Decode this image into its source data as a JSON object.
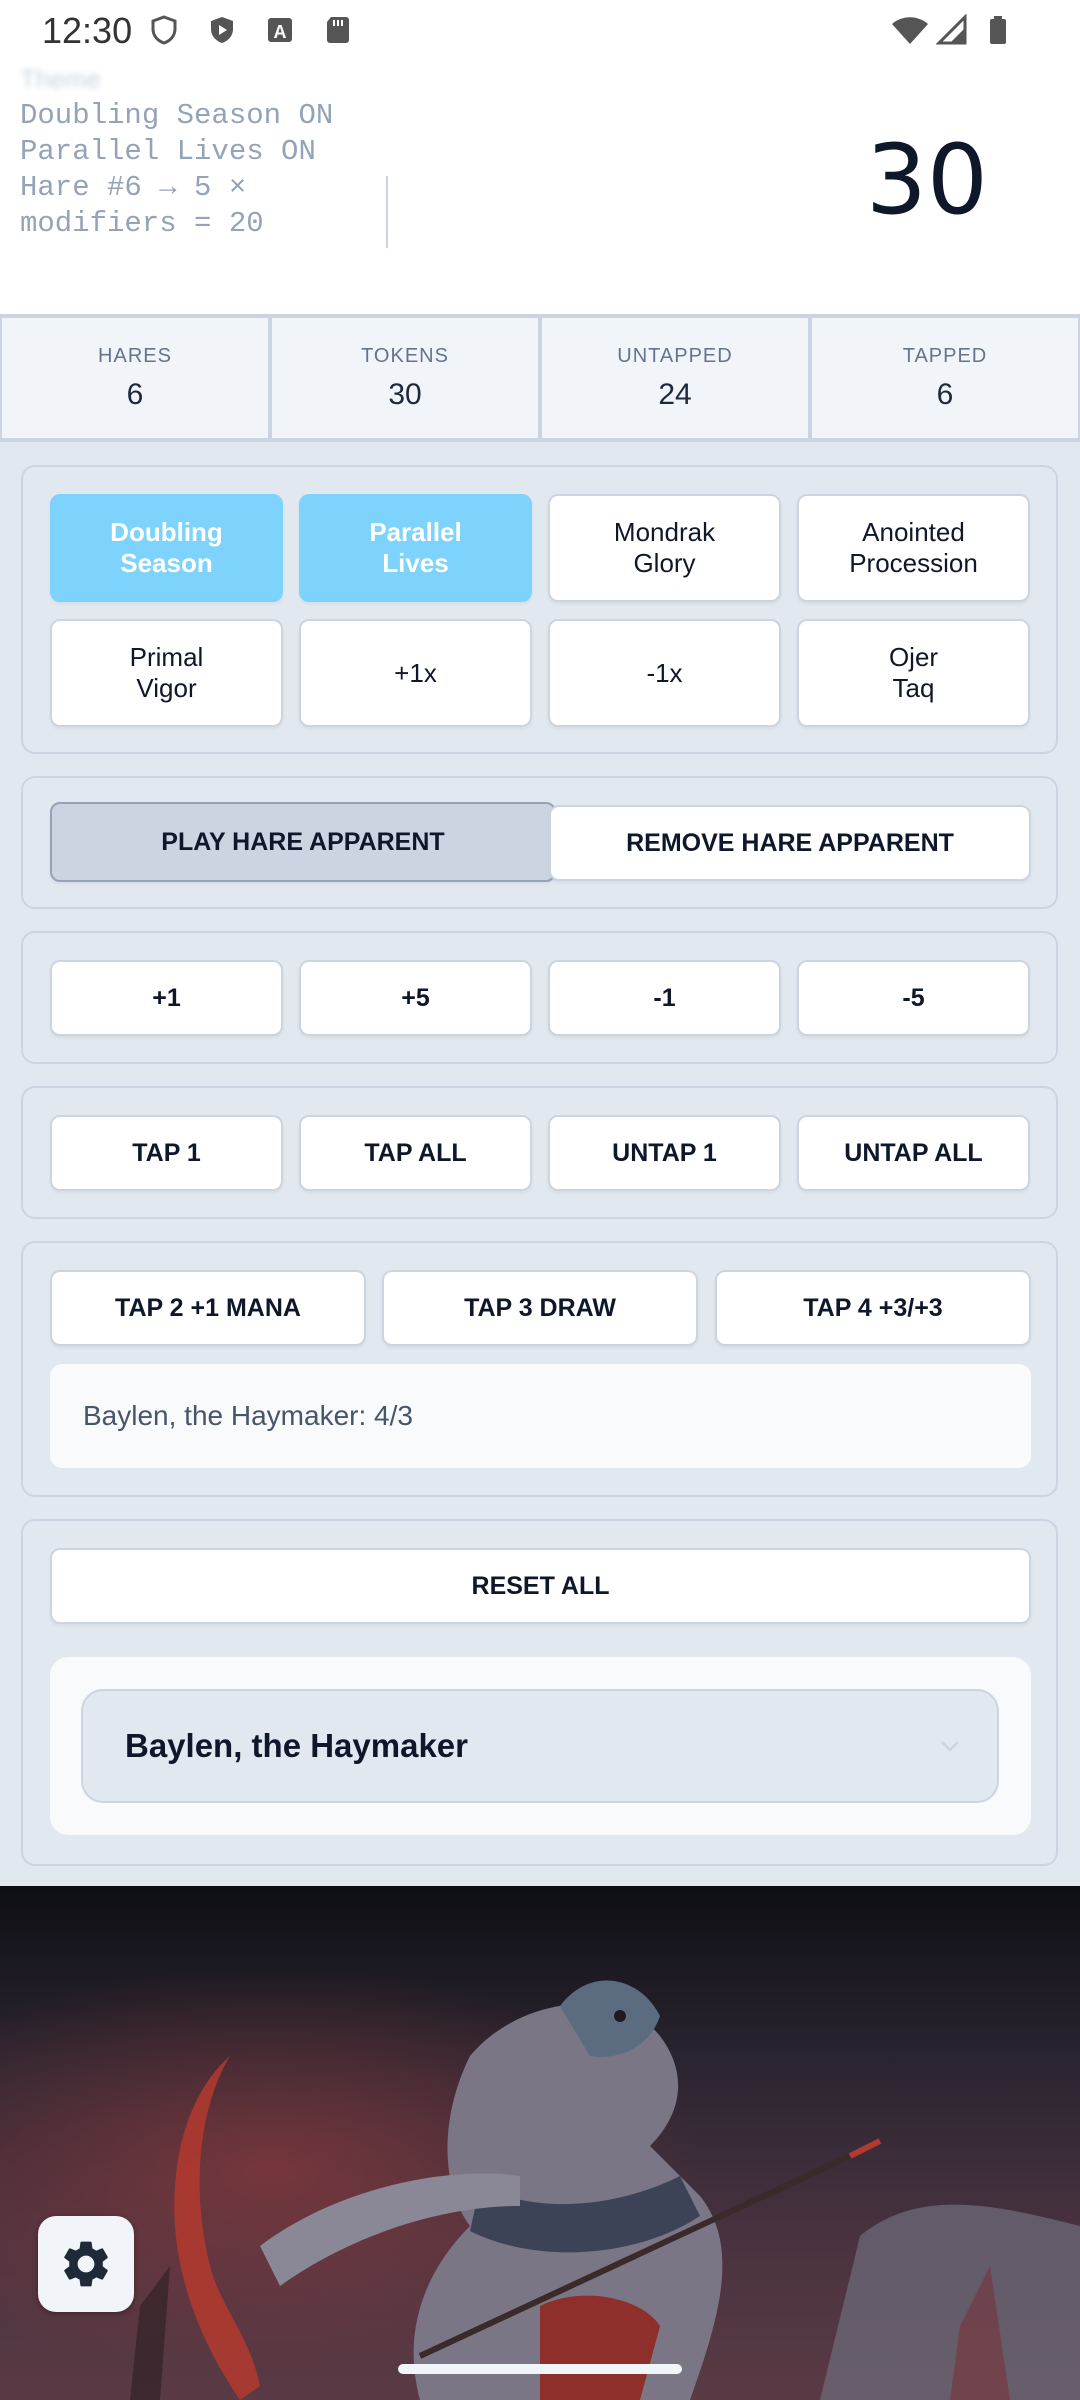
{
  "status_bar": {
    "time": "12:30"
  },
  "header": {
    "theme_label": "Theme",
    "log_lines": [
      "Doubling Season ON",
      "Parallel Lives ON",
      "Hare #6 → 5 ×",
      "modifiers = 20"
    ],
    "token_total": "30"
  },
  "stats": [
    {
      "label": "HARES",
      "value": "6"
    },
    {
      "label": "TOKENS",
      "value": "30"
    },
    {
      "label": "UNTAPPED",
      "value": "24"
    },
    {
      "label": "TAPPED",
      "value": "6"
    }
  ],
  "modifiers": [
    {
      "label": "Doubling\nSeason",
      "active": true
    },
    {
      "label": "Parallel\nLives",
      "active": true
    },
    {
      "label": "Mondrak\nGlory",
      "active": false
    },
    {
      "label": "Anointed\nProcession",
      "active": false
    },
    {
      "label": "Primal\nVigor",
      "active": false
    },
    {
      "label": "+1x",
      "active": false
    },
    {
      "label": "-1x",
      "active": false
    },
    {
      "label": "Ojer\nTaq",
      "active": false
    }
  ],
  "hare_actions": {
    "play": "PLAY HARE APPARENT",
    "remove": "REMOVE HARE APPARENT"
  },
  "adjust": [
    "+1",
    "+5",
    "-1",
    "-5"
  ],
  "tap_actions": [
    "TAP 1",
    "TAP ALL",
    "UNTAP 1",
    "UNTAP ALL"
  ],
  "abilities": [
    "TAP 2 +1 MANA",
    "TAP 3 DRAW",
    "TAP 4 +3/+3"
  ],
  "commander_stats": "Baylen, the Haymaker: 4/3",
  "reset_label": "RESET ALL",
  "commander_select": {
    "selected": "Baylen, the Haymaker"
  },
  "icons": {
    "settings": "gear-icon",
    "dropdown": "chevron-down-icon"
  },
  "colors": {
    "active_toggle": "#7dd3fc",
    "panel": "#e2e8f0"
  }
}
